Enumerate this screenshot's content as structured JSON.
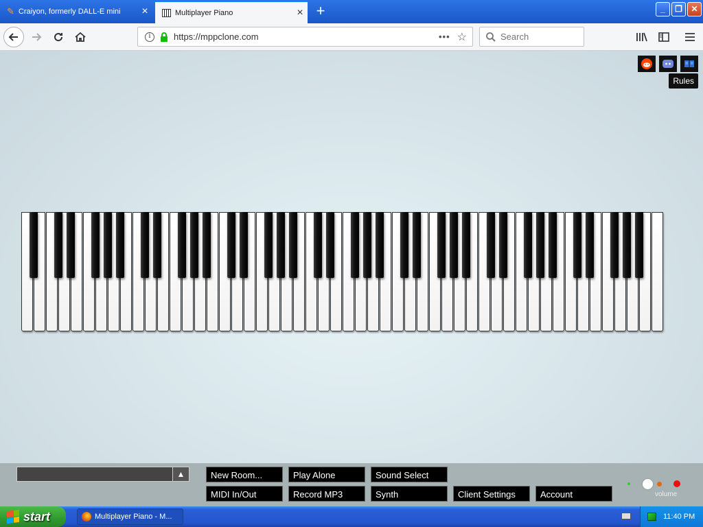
{
  "browser": {
    "tabs": [
      {
        "title": "Craiyon, formerly DALL-E mini",
        "active": false
      },
      {
        "title": "Multiplayer Piano",
        "active": true
      }
    ],
    "url": "https://mppclone.com",
    "search_placeholder": "Search"
  },
  "page": {
    "tooltip": "Rules",
    "white_key_count": 52,
    "chat_toggle": "▲",
    "buttons": {
      "new_room": "New Room...",
      "play_alone": "Play Alone",
      "sound_select": "Sound Select",
      "midi": "MIDI In/Out",
      "record": "Record MP3",
      "synth": "Synth",
      "client_settings": "Client Settings",
      "account": "Account"
    },
    "volume_label": "volume"
  },
  "taskbar": {
    "start_label": "start",
    "task_item": "Multiplayer Piano - M...",
    "clock": "11:40 PM"
  },
  "colors": {
    "xp_blue": "#2455cf",
    "start_green": "#2f9a2e",
    "ssl_green": "#12bc00"
  }
}
